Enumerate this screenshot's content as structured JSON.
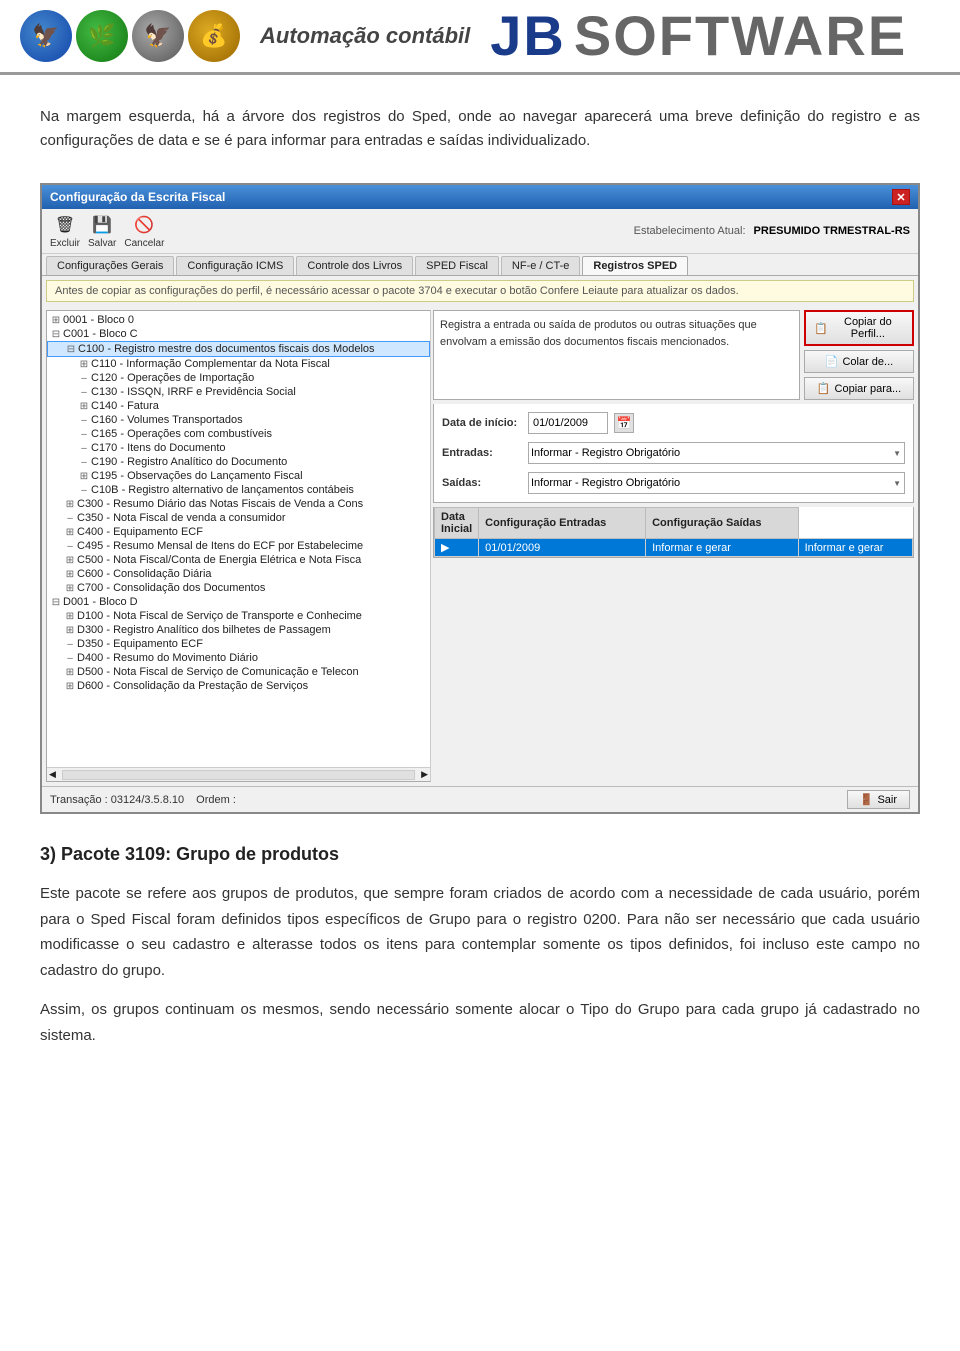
{
  "header": {
    "automacao_label": "Automação contábil",
    "jb_label": "JB",
    "software_label": "SOFTWARE"
  },
  "intro": {
    "text": "Na margem esquerda, há a árvore dos registros do Sped, onde ao navegar aparecerá uma breve definição do registro e as configurações de data e se é para informar para entradas e saídas individualizado."
  },
  "window": {
    "title": "Configuração da Escrita Fiscal",
    "estab_label": "Estabelecimento Atual:",
    "estab_value": "PRESUMIDO TRMESTRAL-RS",
    "toolbar": [
      {
        "label": "Excluir",
        "icon": "🗑"
      },
      {
        "label": "Salvar",
        "icon": "💾"
      },
      {
        "label": "Cancelar",
        "icon": "🚫"
      }
    ],
    "tabs": [
      {
        "label": "Configurações Gerais",
        "active": false
      },
      {
        "label": "Configuração ICMS",
        "active": false
      },
      {
        "label": "Controle dos Livros",
        "active": false
      },
      {
        "label": "SPED Fiscal",
        "active": false
      },
      {
        "label": "NF-e / CT-e",
        "active": false
      },
      {
        "label": "Registros SPED",
        "active": true
      }
    ],
    "info_bar": "Antes de copiar as configurações do perfil, é necessário acessar o pacote 3704 e executar o botão Confere Leiaute para atualizar os dados.",
    "tree": {
      "items": [
        {
          "level": 0,
          "expand": "⊞",
          "label": "0001 - Bloco 0",
          "indent": 0
        },
        {
          "level": 0,
          "expand": "⊟",
          "label": "C001 - Bloco C",
          "indent": 0
        },
        {
          "level": 1,
          "expand": "⊟",
          "label": "C100 - Registro mestre dos documentos fiscais dos Modelos",
          "indent": 14,
          "highlighted": true
        },
        {
          "level": 2,
          "expand": "⊞",
          "label": "C110 - Informação Complementar da Nota Fiscal",
          "indent": 28
        },
        {
          "level": 2,
          "expand": "",
          "label": "C120 - Operações de Importação",
          "indent": 28
        },
        {
          "level": 2,
          "expand": "",
          "label": "C130 - ISSQN, IRRF e Previdência Social",
          "indent": 28
        },
        {
          "level": 2,
          "expand": "⊞",
          "label": "C140 - Fatura",
          "indent": 28
        },
        {
          "level": 2,
          "expand": "",
          "label": "C160 - Volumes Transportados",
          "indent": 28
        },
        {
          "level": 2,
          "expand": "",
          "label": "C165 - Operações com combustíveis",
          "indent": 28
        },
        {
          "level": 2,
          "expand": "",
          "label": "C170 - Itens do Documento",
          "indent": 28
        },
        {
          "level": 2,
          "expand": "",
          "label": "C190 - Registro Analítico do Documento",
          "indent": 28
        },
        {
          "level": 2,
          "expand": "⊞",
          "label": "C195 - Observações do Lançamento Fiscal",
          "indent": 28
        },
        {
          "level": 2,
          "expand": "",
          "label": "C10B - Registro alternativo de lançamentos contábeis",
          "indent": 28
        },
        {
          "level": 1,
          "expand": "⊞",
          "label": "C300 - Resumo Diário das Notas Fiscais de Venda a Cons",
          "indent": 14
        },
        {
          "level": 1,
          "expand": "",
          "label": "C350 - Nota Fiscal de venda a consumidor",
          "indent": 14
        },
        {
          "level": 1,
          "expand": "⊞",
          "label": "C400 - Equipamento ECF",
          "indent": 14
        },
        {
          "level": 1,
          "expand": "",
          "label": "C495 - Resumo Mensal de Itens do ECF por Estabelecime",
          "indent": 14
        },
        {
          "level": 1,
          "expand": "⊞",
          "label": "C500 - Nota Fiscal/Conta de Energia Elétrica e Nota Fisca",
          "indent": 14
        },
        {
          "level": 1,
          "expand": "⊞",
          "label": "C600 - Consolidação Diária",
          "indent": 14
        },
        {
          "level": 1,
          "expand": "⊞",
          "label": "C700 - Consolidação dos Documentos",
          "indent": 14
        },
        {
          "level": 0,
          "expand": "⊟",
          "label": "D001 - Bloco D",
          "indent": 0
        },
        {
          "level": 1,
          "expand": "⊞",
          "label": "D100 - Nota Fiscal de Serviço de Transporte e Conhecime",
          "indent": 14
        },
        {
          "level": 1,
          "expand": "⊞",
          "label": "D300 - Registro Analítico dos bilhetes de Passagem",
          "indent": 14
        },
        {
          "level": 1,
          "expand": "",
          "label": "D350 - Equipamento ECF",
          "indent": 14
        },
        {
          "level": 1,
          "expand": "",
          "label": "D400 - Resumo do Movimento Diário",
          "indent": 14
        },
        {
          "level": 1,
          "expand": "⊞",
          "label": "D500 - Nota Fiscal de Serviço de Comunicação e Telecon",
          "indent": 14
        },
        {
          "level": 1,
          "expand": "⊞",
          "label": "D600 - Consolidação da Prestação de Serviços",
          "indent": 14
        }
      ]
    },
    "description": "Registra a entrada ou saída de produtos ou outras situações que envolvam a emissão dos documentos fiscais mencionados.",
    "action_buttons": [
      {
        "label": "Copiar do Perfil...",
        "icon": "📋"
      },
      {
        "label": "Colar de...",
        "icon": "📄"
      },
      {
        "label": "Copiar para...",
        "icon": "📋"
      }
    ],
    "fields": {
      "data_inicio_label": "Data de início:",
      "data_inicio_value": "01/01/2009",
      "entradas_label": "Entradas:",
      "entradas_value": "Informar - Registro Obrigatório",
      "saidas_label": "Saídas:",
      "saidas_value": "Informar - Registro Obrigatório"
    },
    "table": {
      "headers": [
        "Data Inicial",
        "Configuração Entradas",
        "Configuração Saídas"
      ],
      "rows": [
        {
          "data": "01/01/2009",
          "entradas": "Informar e gerar",
          "saidas": "Informar e gerar",
          "selected": true
        }
      ]
    },
    "status": {
      "transacao": "Transação : 03124/3.5.8.10",
      "ordem": "Ordem :",
      "sair": "Sair"
    }
  },
  "section3": {
    "heading": "3) Pacote 3109: Grupo de produtos",
    "paragraphs": [
      "Este pacote se refere aos grupos de produtos, que sempre foram criados de acordo com a necessidade de cada usuário, porém para o Sped Fiscal foram definidos tipos específicos de Grupo para o registro 0200. Para não ser necessário que cada usuário modificasse o seu cadastro e alterasse todos os itens para contemplar somente os tipos definidos, foi incluso este campo no cadastro do grupo.",
      "Assim, os grupos continuam os mesmos, sendo necessário somente alocar o Tipo do Grupo para cada grupo já cadastrado no sistema."
    ]
  }
}
